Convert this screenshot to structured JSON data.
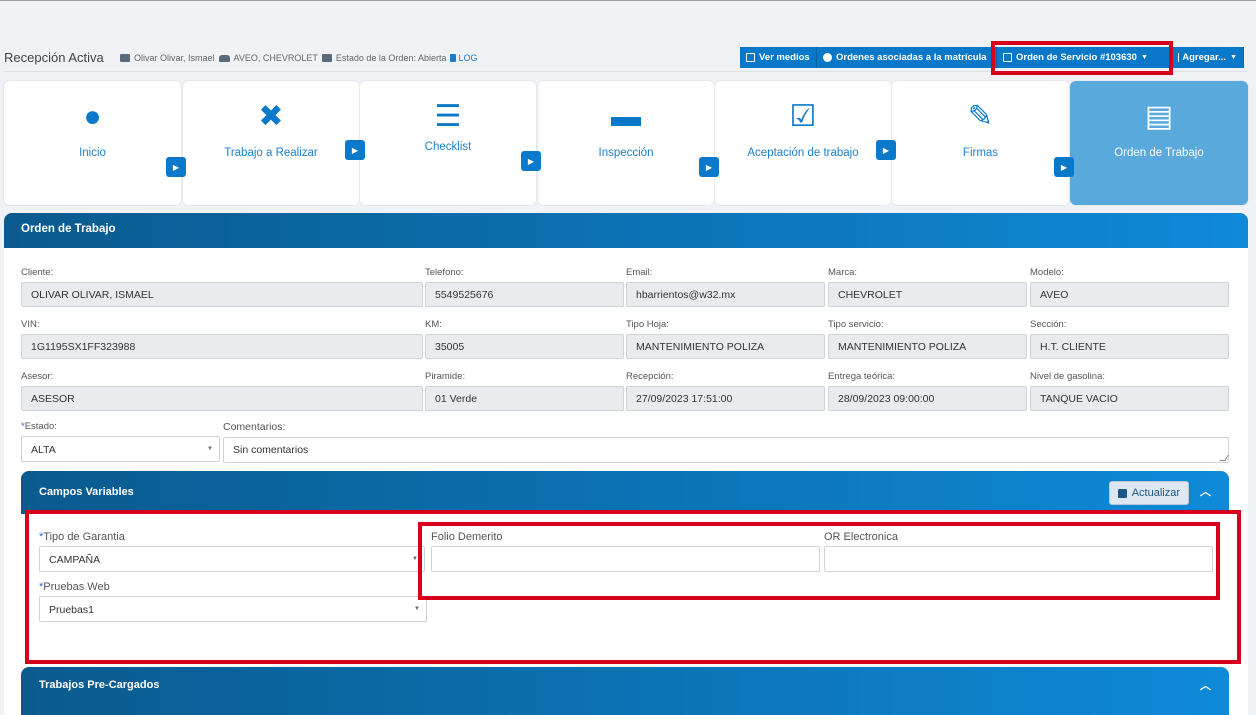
{
  "header": {
    "title": "Recepción Activa",
    "client": "Olivar Olivar, Ismael",
    "vehicle": "AVEO, CHEVROLET",
    "status": "Estado de la Orden: Abierta",
    "log": "LOG"
  },
  "toolbar": {
    "ver_medios": "Ver medios",
    "ordenes_asociadas": "Ordenes asociadas a la matrícula",
    "orden_servicio": "Orden de Servicio #103630",
    "agregar": "Agregar..."
  },
  "tabs": [
    {
      "label": "Inicio",
      "icon": "user-icon"
    },
    {
      "label": "Trabajo a Realizar",
      "icon": "tools-icon"
    },
    {
      "label": "Checklist",
      "icon": "list-icon"
    },
    {
      "label": "Inspección",
      "icon": "car-icon"
    },
    {
      "label": "Aceptación de trabajo",
      "icon": "check-icon"
    },
    {
      "label": "Firmas",
      "icon": "signature-icon"
    },
    {
      "label": "Orden de Trabajo",
      "icon": "document-icon"
    }
  ],
  "panel": {
    "title": "Orden de Trabajo"
  },
  "fields": {
    "cliente": {
      "label": "Cliente:",
      "value": "OLIVAR OLIVAR, ISMAEL"
    },
    "telefono": {
      "label": "Telefono:",
      "value": "5549525676"
    },
    "email": {
      "label": "Email:",
      "value": "hbarrientos@w32.mx"
    },
    "marca": {
      "label": "Marca:",
      "value": "CHEVROLET"
    },
    "modelo": {
      "label": "Modelo:",
      "value": "AVEO"
    },
    "vin": {
      "label": "VIN:",
      "value": "1G1195SX1FF323988"
    },
    "km": {
      "label": "KM:",
      "value": "35005"
    },
    "tipo_hoja": {
      "label": "Tipo Hoja:",
      "value": "MANTENIMIENTO POLIZA"
    },
    "tipo_servicio": {
      "label": "Tipo servicio:",
      "value": "MANTENIMIENTO POLIZA"
    },
    "seccion": {
      "label": "Sección:",
      "value": "H.T. CLIENTE"
    },
    "asesor": {
      "label": "Asesor:",
      "value": "ASESOR"
    },
    "piramide": {
      "label": "Piramide:",
      "value": "01 Verde"
    },
    "recepcion": {
      "label": "Recepción:",
      "value": "27/09/2023 17:51:00"
    },
    "entrega": {
      "label": "Entrega teórica:",
      "value": "28/09/2023 09:00:00"
    },
    "gasolina": {
      "label": "Nivel de gasolina:",
      "value": "TANQUE VACIO"
    },
    "estado": {
      "label": "Estado:",
      "value": "ALTA"
    },
    "comentarios": {
      "label": "Comentarios:",
      "value": "Sin comentarios"
    }
  },
  "campos": {
    "title": "Campos Variables",
    "update": "Actualizar",
    "tipo_garantia": {
      "label": "Tipo de Garantia",
      "value": "CAMPAÑA"
    },
    "folio_demerito": {
      "label": "Folio Demerito",
      "value": ""
    },
    "or_electronica": {
      "label": "OR Electronica",
      "value": ""
    },
    "pruebas_web": {
      "label": "Pruebas Web",
      "value": "Pruebas1"
    }
  },
  "trabajos": {
    "title": "Trabajos Pre-Cargados"
  },
  "colors": {
    "primary": "#0b79c9",
    "highlight": "#d6001c",
    "active_tab": "#5aa9dd"
  }
}
